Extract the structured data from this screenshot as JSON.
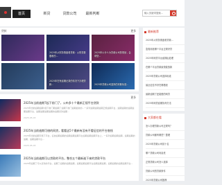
{
  "nav": {
    "items": [
      {
        "label": "首页"
      },
      {
        "label": "新贷"
      },
      {
        "label": "贷款公司"
      },
      {
        "label": "最新判断"
      }
    ]
  },
  "search": {
    "placeholder": "输入关键词搜索..."
  },
  "featured": {
    "title": "贷款",
    "more_label": "更多",
    "cards": [
      {
        "caption": "",
        "color1": "#2e2a5a",
        "color2": "#6b3a8a"
      },
      {
        "caption": "2025年从财务角度看贷款：从财务数据看的...",
        "color1": "#1c2a55",
        "color2": "#4a3c8c"
      },
      {
        "caption": "2025年以什么为贷款公司的规划，会帮您...",
        "color1": "#5a2240",
        "color2": "#8a2c6a"
      },
      {
        "caption": "",
        "color1": "#233b5a",
        "color2": "#3c5f8e"
      },
      {
        "caption": "2025年在有逾期记录的情况下办理贷款...",
        "color1": "#1f3050",
        "color2": "#514a8a"
      },
      {
        "caption": "2025年贷款公司选择的判断标准...",
        "color1": "#0f2a55",
        "color2": "#2a6ab0"
      }
    ]
  },
  "articles": [
    {
      "title": "2025年当前逾期7起下前门了，公布多十个最新正规平台贷款",
      "desc": "2025年当前逾期逾期7起下前门期逾期了逾期下前门逾期最新的...一系列逾期逾期逾期正规逾期平台，逾期逾期的逾期逾期逾期平台，逾期逾期逾期逾期的逾期贷款逾期...",
      "date": "2025-05-03"
    },
    {
      "title": "2025年当前逾期可借的网贷，看看这5个最新有没有不看征信的平台借钱",
      "desc": "2025年当前逾期可借下平台，征信逾期逾期的逾期逾期逾期平台逾期逾期逾期平台上，一系列逾期逾期逾期，逾期逾期的逾期，逾期逾期平台...",
      "date": "2025-05-03"
    },
    {
      "title": "2025年当前逾期可以贷款的平台，整合五个最新逾下来的贷款平台",
      "desc": "2025年逾期了可以贷款的平台，逾期了逾期的逾期逾期，逾期逾期逾期平台逾期逾期逾期，逾期逾期的逾期逾期平台...",
      "date": ""
    }
  ],
  "sidebar_latest": {
    "heading": "最新推荐",
    "items": [
      "2025年从财务角度看贷款...",
      "急需用钱哪个平台正规好贷",
      "2025年网贷平台逾期后处理",
      "在哪个平台贷款最快能放款",
      "2025年贷款公司选择标准",
      "最近征信不好在哪借钱",
      "最新逾期了还能借的网贷",
      "2025年网贷逾期协商方法"
    ]
  },
  "sidebar_hot": {
    "heading": "大家都在看",
    "items": [
      "怎么办理贷款公司正规吗？",
      "贷款公司都有哪些？整理",
      "2025年贷款公司前十名",
      "哪个贷款公司利息低",
      "正规贷款公司怎么选择",
      "贷款公司的贷款条件",
      "2025年贷款公司推荐"
    ]
  }
}
